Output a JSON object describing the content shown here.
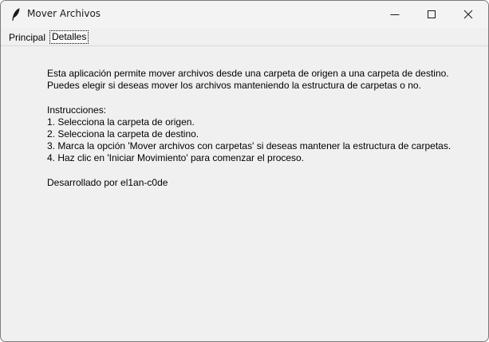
{
  "window": {
    "title": "Mover Archivos",
    "controls": {
      "minimize": "minimize-icon",
      "maximize": "maximize-icon",
      "close": "close-icon"
    }
  },
  "tabs": [
    {
      "label": "Principal",
      "selected": false
    },
    {
      "label": "Detalles",
      "selected": true
    }
  ],
  "details": {
    "description": [
      "Esta aplicación permite mover archivos desde una carpeta de origen a una carpeta de destino.",
      "Puedes elegir si deseas mover los archivos manteniendo la estructura de carpetas o no."
    ],
    "instructions_heading": "Instrucciones:",
    "instructions": [
      "1. Selecciona la carpeta de origen.",
      "2. Selecciona la carpeta de destino.",
      "3. Marca la opción 'Mover archivos con carpetas' si deseas mantener la estructura de carpetas.",
      "4. Haz clic en 'Iniciar Movimiento' para comenzar el proceso."
    ],
    "credit": "Desarrollado por el1an-c0de"
  }
}
